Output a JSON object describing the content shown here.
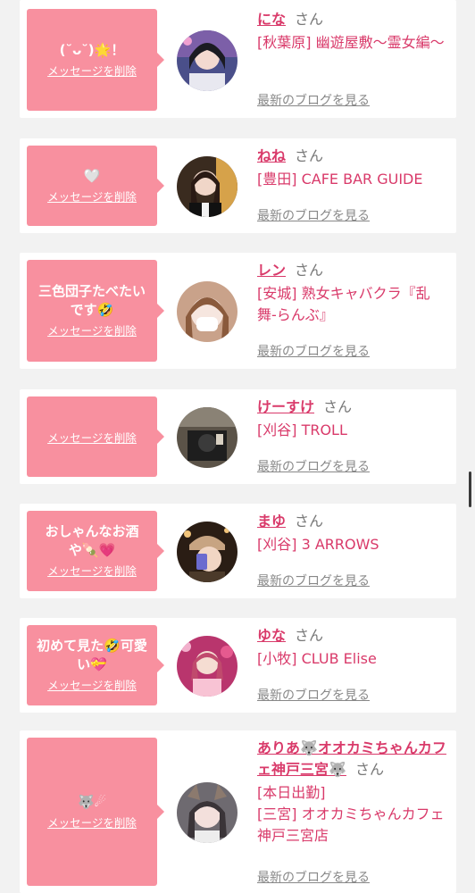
{
  "delete_label": "メッセージを削除",
  "blog_label": "最新のブログを見る",
  "suffix": "さん",
  "colors": {
    "accent": "#d93a6a",
    "bubble": "#f8909f",
    "background": "#f2f2f2"
  },
  "cards": [
    {
      "message": "(˘ᴗ˘)🌟！",
      "name": "にな",
      "shop": "[秋葉原] 幽遊屋敷〜霊女編〜"
    },
    {
      "message": "🤍",
      "name": "ねね",
      "shop": "[豊田] CAFE BAR GUIDE"
    },
    {
      "message": "三色団子たべたいです🤣",
      "name": "レン",
      "shop": "[安城] 熟女キャバクラ『乱舞-らんぶ』"
    },
    {
      "message": "",
      "name": "けーすけ",
      "shop": "[刈谷] TROLL"
    },
    {
      "message": "おしゃんなお酒や🍡💗",
      "name": "まゆ",
      "shop": "[刈谷] 3 ARROWS"
    },
    {
      "message": "初めて見た🤣可愛い💝",
      "name": "ゆな",
      "shop": "[小牧] CLUB Elise"
    },
    {
      "message": "🐺☄",
      "name": "ありあ🐺オオカミちゃんカフェ神戸三宮🐺",
      "status": "[本日出勤]",
      "shop": "[三宮] オオカミちゃんカフェ神戸三宮店"
    }
  ]
}
